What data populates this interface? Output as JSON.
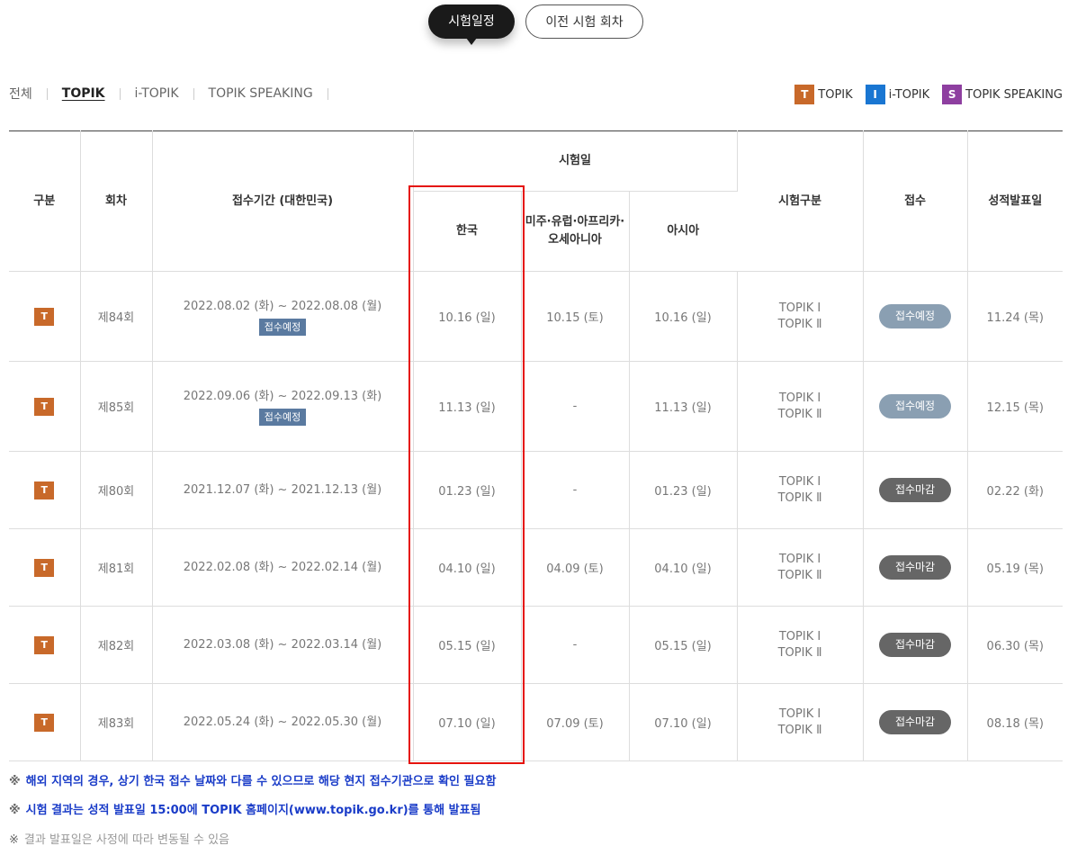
{
  "top_tabs": [
    {
      "label": "시험일정"
    },
    {
      "label": "이전 시험 회차"
    }
  ],
  "filters": [
    {
      "label": "전체"
    },
    {
      "label": "TOPIK"
    },
    {
      "label": "i-TOPIK"
    },
    {
      "label": "TOPIK SPEAKING"
    }
  ],
  "legend": [
    {
      "badge": "T",
      "label": "TOPIK",
      "color": "#c8692a"
    },
    {
      "badge": "I",
      "label": "i-TOPIK",
      "color": "#1976d2"
    },
    {
      "badge": "S",
      "label": "TOPIK SPEAKING",
      "color": "#8e3fa0"
    }
  ],
  "headers": {
    "category": "구분",
    "round": "회차",
    "period": "접수기간 (대한민국)",
    "exam_date": "시험일",
    "korea": "한국",
    "americas": "미주·유럽·아프리카·오세아니아",
    "asia": "아시아",
    "exam_type": "시험구분",
    "registration": "접수",
    "result_date": "성적발표일"
  },
  "rows": [
    {
      "badge": "T",
      "round": "제84회",
      "period": "2022.08.02 (화) ~ 2022.08.08 (월)",
      "tag": "접수예정",
      "korea": "10.16 (일)",
      "americas": "10.15 (토)",
      "asia": "10.16 (일)",
      "level1": "TOPIK Ⅰ",
      "level2": "TOPIK Ⅱ",
      "status": "접수예정",
      "result": "11.24 (목)"
    },
    {
      "badge": "T",
      "round": "제85회",
      "period": "2022.09.06 (화) ~ 2022.09.13 (화)",
      "tag": "접수예정",
      "korea": "11.13 (일)",
      "americas": "-",
      "asia": "11.13 (일)",
      "level1": "TOPIK Ⅰ",
      "level2": "TOPIK Ⅱ",
      "status": "접수예정",
      "result": "12.15 (목)"
    },
    {
      "badge": "T",
      "round": "제80회",
      "period": "2021.12.07 (화) ~ 2021.12.13 (월)",
      "tag": "",
      "korea": "01.23 (일)",
      "americas": "-",
      "asia": "01.23 (일)",
      "level1": "TOPIK Ⅰ",
      "level2": "TOPIK Ⅱ",
      "status": "접수마감",
      "result": "02.22 (화)"
    },
    {
      "badge": "T",
      "round": "제81회",
      "period": "2022.02.08 (화) ~ 2022.02.14 (월)",
      "tag": "",
      "korea": "04.10 (일)",
      "americas": "04.09 (토)",
      "asia": "04.10 (일)",
      "level1": "TOPIK Ⅰ",
      "level2": "TOPIK Ⅱ",
      "status": "접수마감",
      "result": "05.19 (목)"
    },
    {
      "badge": "T",
      "round": "제82회",
      "period": "2022.03.08 (화) ~ 2022.03.14 (월)",
      "tag": "",
      "korea": "05.15 (일)",
      "americas": "-",
      "asia": "05.15 (일)",
      "level1": "TOPIK Ⅰ",
      "level2": "TOPIK Ⅱ",
      "status": "접수마감",
      "result": "06.30 (목)"
    },
    {
      "badge": "T",
      "round": "제83회",
      "period": "2022.05.24 (화) ~ 2022.05.30 (월)",
      "tag": "",
      "korea": "07.10 (일)",
      "americas": "07.09 (토)",
      "asia": "07.10 (일)",
      "level1": "TOPIK Ⅰ",
      "level2": "TOPIK Ⅱ",
      "status": "접수마감",
      "result": "08.18 (목)"
    }
  ],
  "notes": [
    {
      "mark": "※",
      "text": "해외 지역의 경우, 상기 한국 접수 날짜와 다를 수 있으므로 해당 현지 접수기관으로 확인 필요함"
    },
    {
      "mark": "※",
      "text": "시험 결과는 성적 발표일 15:00에 TOPIK 홈페이지(www.topik.go.kr)를 통해 발표됨"
    },
    {
      "mark": "※",
      "text": "결과 발표일은 사정에 따라 변동될 수 있음"
    }
  ]
}
